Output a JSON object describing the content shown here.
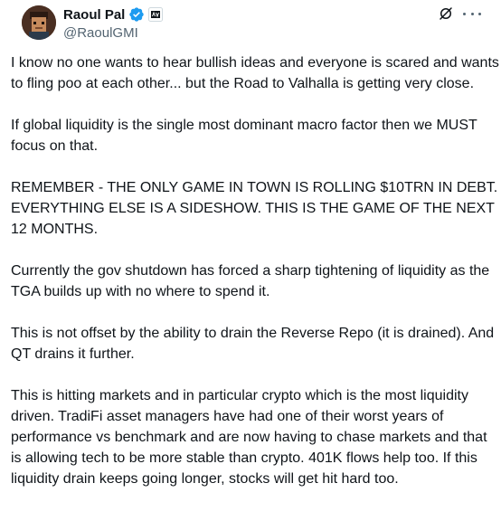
{
  "author": {
    "display_name": "Raoul Pal",
    "handle": "@RaoulGMI"
  },
  "icons": {
    "verified": "verified-badge-icon",
    "affiliate": "affiliate-logo-icon",
    "grok": "grok-icon",
    "more": "more-options-icon"
  },
  "colors": {
    "verified": "#1d9bf0",
    "text": "#0f1419",
    "secondary": "#536471"
  },
  "tweet": {
    "paragraphs": [
      "I know no one wants to hear bullish ideas and everyone is scared and wants to fling poo at each other... but the Road to Valhalla is getting very close.",
      "If global liquidity is the single most dominant macro factor then we MUST focus on that.",
      "REMEMBER - THE ONLY GAME IN TOWN IS ROLLING $10TRN IN DEBT. EVERYTHING ELSE IS A SIDESHOW. THIS IS THE GAME OF THE NEXT 12 MONTHS.",
      "Currently the gov shutdown has forced a sharp tightening of liquidity as the TGA builds up with no where to spend it.",
      "This is not offset by the ability to drain the Reverse Repo (it is drained). And QT drains it further.",
      "This is hitting markets and in particular crypto which is the most liquidity driven. TradiFi asset managers have had one of their worst years of performance vs benchmark and are now having to chase markets and that is allowing tech to be more stable than crypto. 401K flows help too. If this liquidity drain keeps going longer, stocks will get hit hard too."
    ]
  }
}
